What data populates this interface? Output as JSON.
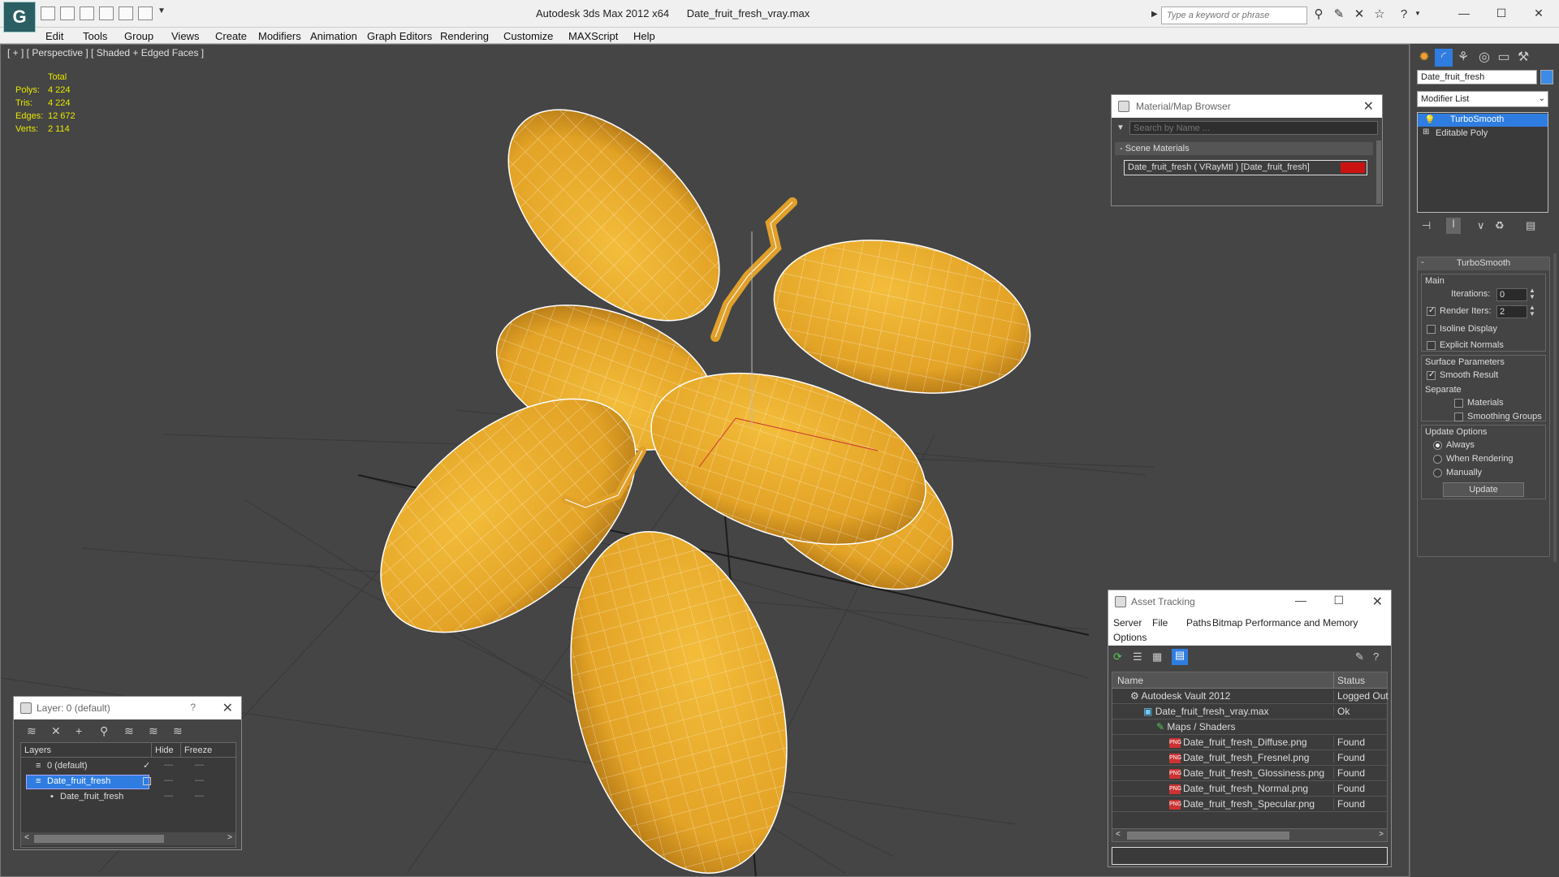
{
  "window": {
    "app_title": "Autodesk 3ds Max  2012 x64",
    "file_title": "Date_fruit_fresh_vray.max",
    "search_placeholder": "Type a keyword or phrase"
  },
  "menu": [
    "Edit",
    "Tools",
    "Group",
    "Views",
    "Create",
    "Modifiers",
    "Animation",
    "Graph Editors",
    "Rendering",
    "Customize",
    "MAXScript",
    "Help"
  ],
  "viewport": {
    "label": "[ + ] [ Perspective ] [ Shaded + Edged Faces ]",
    "stats_header": "Total",
    "stats": [
      {
        "label": "Polys:",
        "value": "4 224"
      },
      {
        "label": "Tris:",
        "value": "4 224"
      },
      {
        "label": "Edges:",
        "value": "12 672"
      },
      {
        "label": "Verts:",
        "value": "2 114"
      }
    ]
  },
  "material_browser": {
    "title": "Material/Map Browser",
    "search_placeholder": "Search by Name ...",
    "group_label": "Scene Materials",
    "material": "Date_fruit_fresh  ( VRayMtl ) [Date_fruit_fresh]",
    "swatch_color": "#cc1111"
  },
  "asset_tracking": {
    "title": "Asset Tracking",
    "menu": [
      "Server",
      "File",
      "Paths",
      "Bitmap Performance and Memory",
      "Options"
    ],
    "col_name": "Name",
    "col_status": "Status",
    "rows": [
      {
        "name": "Autodesk Vault 2012",
        "status": "Logged Out"
      },
      {
        "name": "Date_fruit_fresh_vray.max",
        "status": "Ok"
      },
      {
        "name": "Maps / Shaders",
        "status": ""
      },
      {
        "name": "Date_fruit_fresh_Diffuse.png",
        "status": "Found"
      },
      {
        "name": "Date_fruit_fresh_Fresnel.png",
        "status": "Found"
      },
      {
        "name": "Date_fruit_fresh_Glossiness.png",
        "status": "Found"
      },
      {
        "name": "Date_fruit_fresh_Normal.png",
        "status": "Found"
      },
      {
        "name": "Date_fruit_fresh_Specular.png",
        "status": "Found"
      }
    ]
  },
  "layer_manager": {
    "title": "Layer: 0 (default)",
    "help": "?",
    "col_layers": "Layers",
    "col_hide": "Hide",
    "col_freeze": "Freeze",
    "rows": [
      {
        "name": "0 (default)"
      },
      {
        "name": "Date_fruit_fresh"
      },
      {
        "name": "Date_fruit_fresh"
      }
    ]
  },
  "command_panel": {
    "object_name": "Date_fruit_fresh",
    "modifier_list": "Modifier List",
    "stack": [
      "TurboSmooth",
      "Editable Poly"
    ],
    "rollout_title": "TurboSmooth",
    "main_label": "Main",
    "iterations_label": "Iterations:",
    "iterations_value": "0",
    "render_iters_label": "Render Iters:",
    "render_iters_value": "2",
    "render_iters_checked": true,
    "isoline_label": "Isoline Display",
    "explicit_normals_label": "Explicit Normals",
    "surface_params_label": "Surface Parameters",
    "smooth_result_label": "Smooth Result",
    "smooth_result_checked": true,
    "separate_label": "Separate",
    "materials_label": "Materials",
    "smoothing_groups_label": "Smoothing Groups",
    "update_options_label": "Update Options",
    "always_label": "Always",
    "when_rendering_label": "When Rendering",
    "manually_label": "Manually",
    "update_button": "Update"
  },
  "colors": {
    "selection_blue": "#2f7de1",
    "fruit_yellow": "#e8a92a",
    "stats_yellow": "#e8e800"
  }
}
